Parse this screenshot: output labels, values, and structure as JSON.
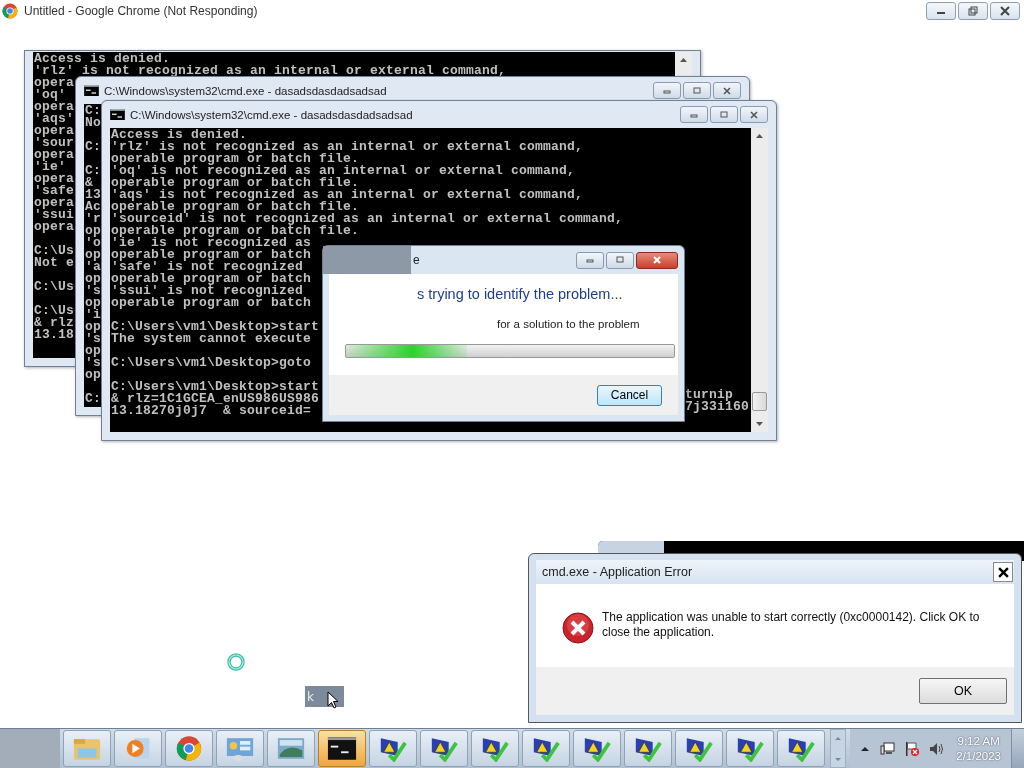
{
  "chrome_window": {
    "title": "Untitled - Google Chrome (Not Responding)"
  },
  "cmd_windows": [
    {
      "blocks": [
        [
          "Access is denied.",
          "'rlz' is not recognized as an internal or external command,",
          "opera",
          "'oq'",
          "opera",
          "'aqs'",
          "opera",
          "'sour",
          "opera",
          "'ie'",
          "opera",
          "'safe",
          "opera",
          "'ssui",
          "opera"
        ],
        [
          "C:\\Us",
          "Not e"
        ],
        [
          "C:\\Us"
        ],
        [
          "C:\\Us",
          "& rlz",
          "13.18"
        ]
      ]
    },
    {
      "title": "C:\\Windows\\system32\\cmd.exe - dasadsdasdadsadsad",
      "blocks": [
        [
          "C:",
          "No"
        ],
        [
          "C:"
        ],
        [
          "C:",
          "&",
          "13",
          "Ac",
          "'r",
          "op",
          "'o",
          "op",
          "'a",
          "op",
          "'s",
          "op",
          "'i",
          "op",
          "'s",
          "op",
          "'s",
          "op"
        ],
        [
          "C:"
        ]
      ]
    },
    {
      "title": "C:\\Windows\\system32\\cmd.exe - dasadsdasdadsadsad",
      "blocks": [
        [
          "Access is denied.",
          "'rlz' is not recognized as an internal or external command,",
          "operable program or batch file.",
          "'oq' is not recognized as an internal or external command,",
          "operable program or batch file.",
          "'aqs' is not recognized as an internal or external command,",
          "operable program or batch file.",
          "'sourceid' is not recognized as an internal or external command,",
          "operable program or batch file.",
          "'ie' is not recognized as",
          "operable program or batch",
          "'safe' is not recognized",
          "operable program or batch",
          "'ssui' is not recognized",
          "operable program or batch"
        ],
        [
          "C:\\Users\\vm1\\Desktop>start",
          "The system cannot execute"
        ],
        [
          "C:\\Users\\vm1\\Desktop>goto"
        ],
        [
          "C:\\Users\\vm1\\Desktop>start",
          "& rlz=1C1GCEA_enUS986US986",
          "13.18270j0j7  & sourceid="
        ]
      ],
      "fragments": [
        "turnip",
        "7j33i160"
      ]
    }
  ],
  "troubleshooter_dialog": {
    "title": "e",
    "heading": "s trying to identify the problem...",
    "status": "for a solution to the problem",
    "progress": {
      "level": 0.37
    },
    "buttons": [
      "Cancel"
    ]
  },
  "error_dialog": {
    "title": "cmd.exe - Application Error",
    "message": "The application was unable to start correctly (0xc0000142). Click OK to close the application.",
    "buttons": [
      "OK"
    ]
  },
  "thumbnail_fragment": {
    "text": "k"
  },
  "taskbar": {
    "items": [
      {
        "kind": "folder",
        "selected": false
      },
      {
        "kind": "media",
        "selected": false
      },
      {
        "kind": "chrome",
        "selected": false
      },
      {
        "kind": "panel",
        "selected": false
      },
      {
        "kind": "photo",
        "selected": false
      },
      {
        "kind": "console",
        "selected": true
      },
      {
        "kind": "alert",
        "selected": false
      },
      {
        "kind": "alert",
        "selected": false
      },
      {
        "kind": "alert",
        "selected": false
      },
      {
        "kind": "alert",
        "selected": false
      },
      {
        "kind": "alert",
        "selected": false
      },
      {
        "kind": "alert",
        "selected": false
      },
      {
        "kind": "alert",
        "selected": false
      },
      {
        "kind": "alert",
        "selected": false
      },
      {
        "kind": "alert",
        "selected": false
      }
    ],
    "clock": {
      "time": "9:12 AM",
      "date": "2/1/2023"
    }
  }
}
